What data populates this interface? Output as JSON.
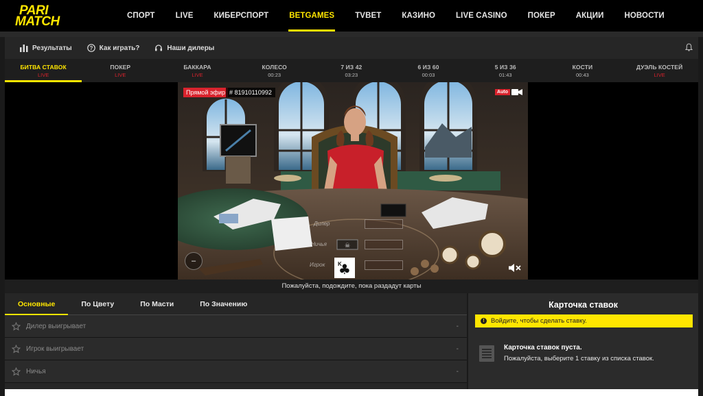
{
  "brand": {
    "line1": "PARI",
    "line2": "MATCH",
    "color": "#ffe600"
  },
  "nav": [
    {
      "label": "СПОРТ"
    },
    {
      "label": "LIVE"
    },
    {
      "label": "КИБЕРСПОРТ"
    },
    {
      "label": "BETGAMES",
      "active": true
    },
    {
      "label": "TVBET"
    },
    {
      "label": "КАЗИНО"
    },
    {
      "label": "LIVE CASINO"
    },
    {
      "label": "ПОКЕР"
    },
    {
      "label": "АКЦИИ"
    },
    {
      "label": "НОВОСТИ"
    }
  ],
  "toolbar": {
    "results": "Результаты",
    "how_to_play": "Как играть?",
    "dealers": "Наши дилеры"
  },
  "game_tabs": [
    {
      "name": "БИТВА СТАВОК",
      "sub": "LIVE",
      "live": true,
      "active": true
    },
    {
      "name": "ПОКЕР",
      "sub": "LIVE",
      "live": true
    },
    {
      "name": "БАККАРА",
      "sub": "LIVE",
      "live": true
    },
    {
      "name": "КОЛЕСО",
      "sub": "00:23"
    },
    {
      "name": "7 ИЗ 42",
      "sub": "03:23"
    },
    {
      "name": "6 ИЗ 60",
      "sub": "00:03"
    },
    {
      "name": "5 ИЗ 36",
      "sub": "01:43"
    },
    {
      "name": "КОСТИ",
      "sub": "00:43"
    },
    {
      "name": "ДУЭЛЬ КОСТЕЙ",
      "sub": "LIVE",
      "live": true
    }
  ],
  "video": {
    "live_badge": "Прямой эфир",
    "round_id": "# 81910110992",
    "auto": "Auto",
    "dealer_label": "Дилер",
    "draw_label": "Ничья",
    "player_label": "Игрок",
    "status": "Пожалуйста, подождите, пока раздадут карты"
  },
  "bet_tabs": [
    {
      "label": "Основные",
      "active": true
    },
    {
      "label": "По Цвету"
    },
    {
      "label": "По Масти"
    },
    {
      "label": "По Значению"
    }
  ],
  "bet_rows": [
    {
      "label": "Дилер выигрывает",
      "value": "-"
    },
    {
      "label": "Игрок выигрывает",
      "value": "-"
    },
    {
      "label": "Ничья",
      "value": "-"
    }
  ],
  "coupon": {
    "title": "Карточка ставок",
    "login_notice": "Войдите, чтобы сделать ставку.",
    "empty_title": "Карточка ставок пуста.",
    "empty_sub": "Пожалуйста, выберите 1 ставку из списка ставок."
  },
  "colors": {
    "accent": "#ffe600",
    "live": "#d9232d"
  }
}
